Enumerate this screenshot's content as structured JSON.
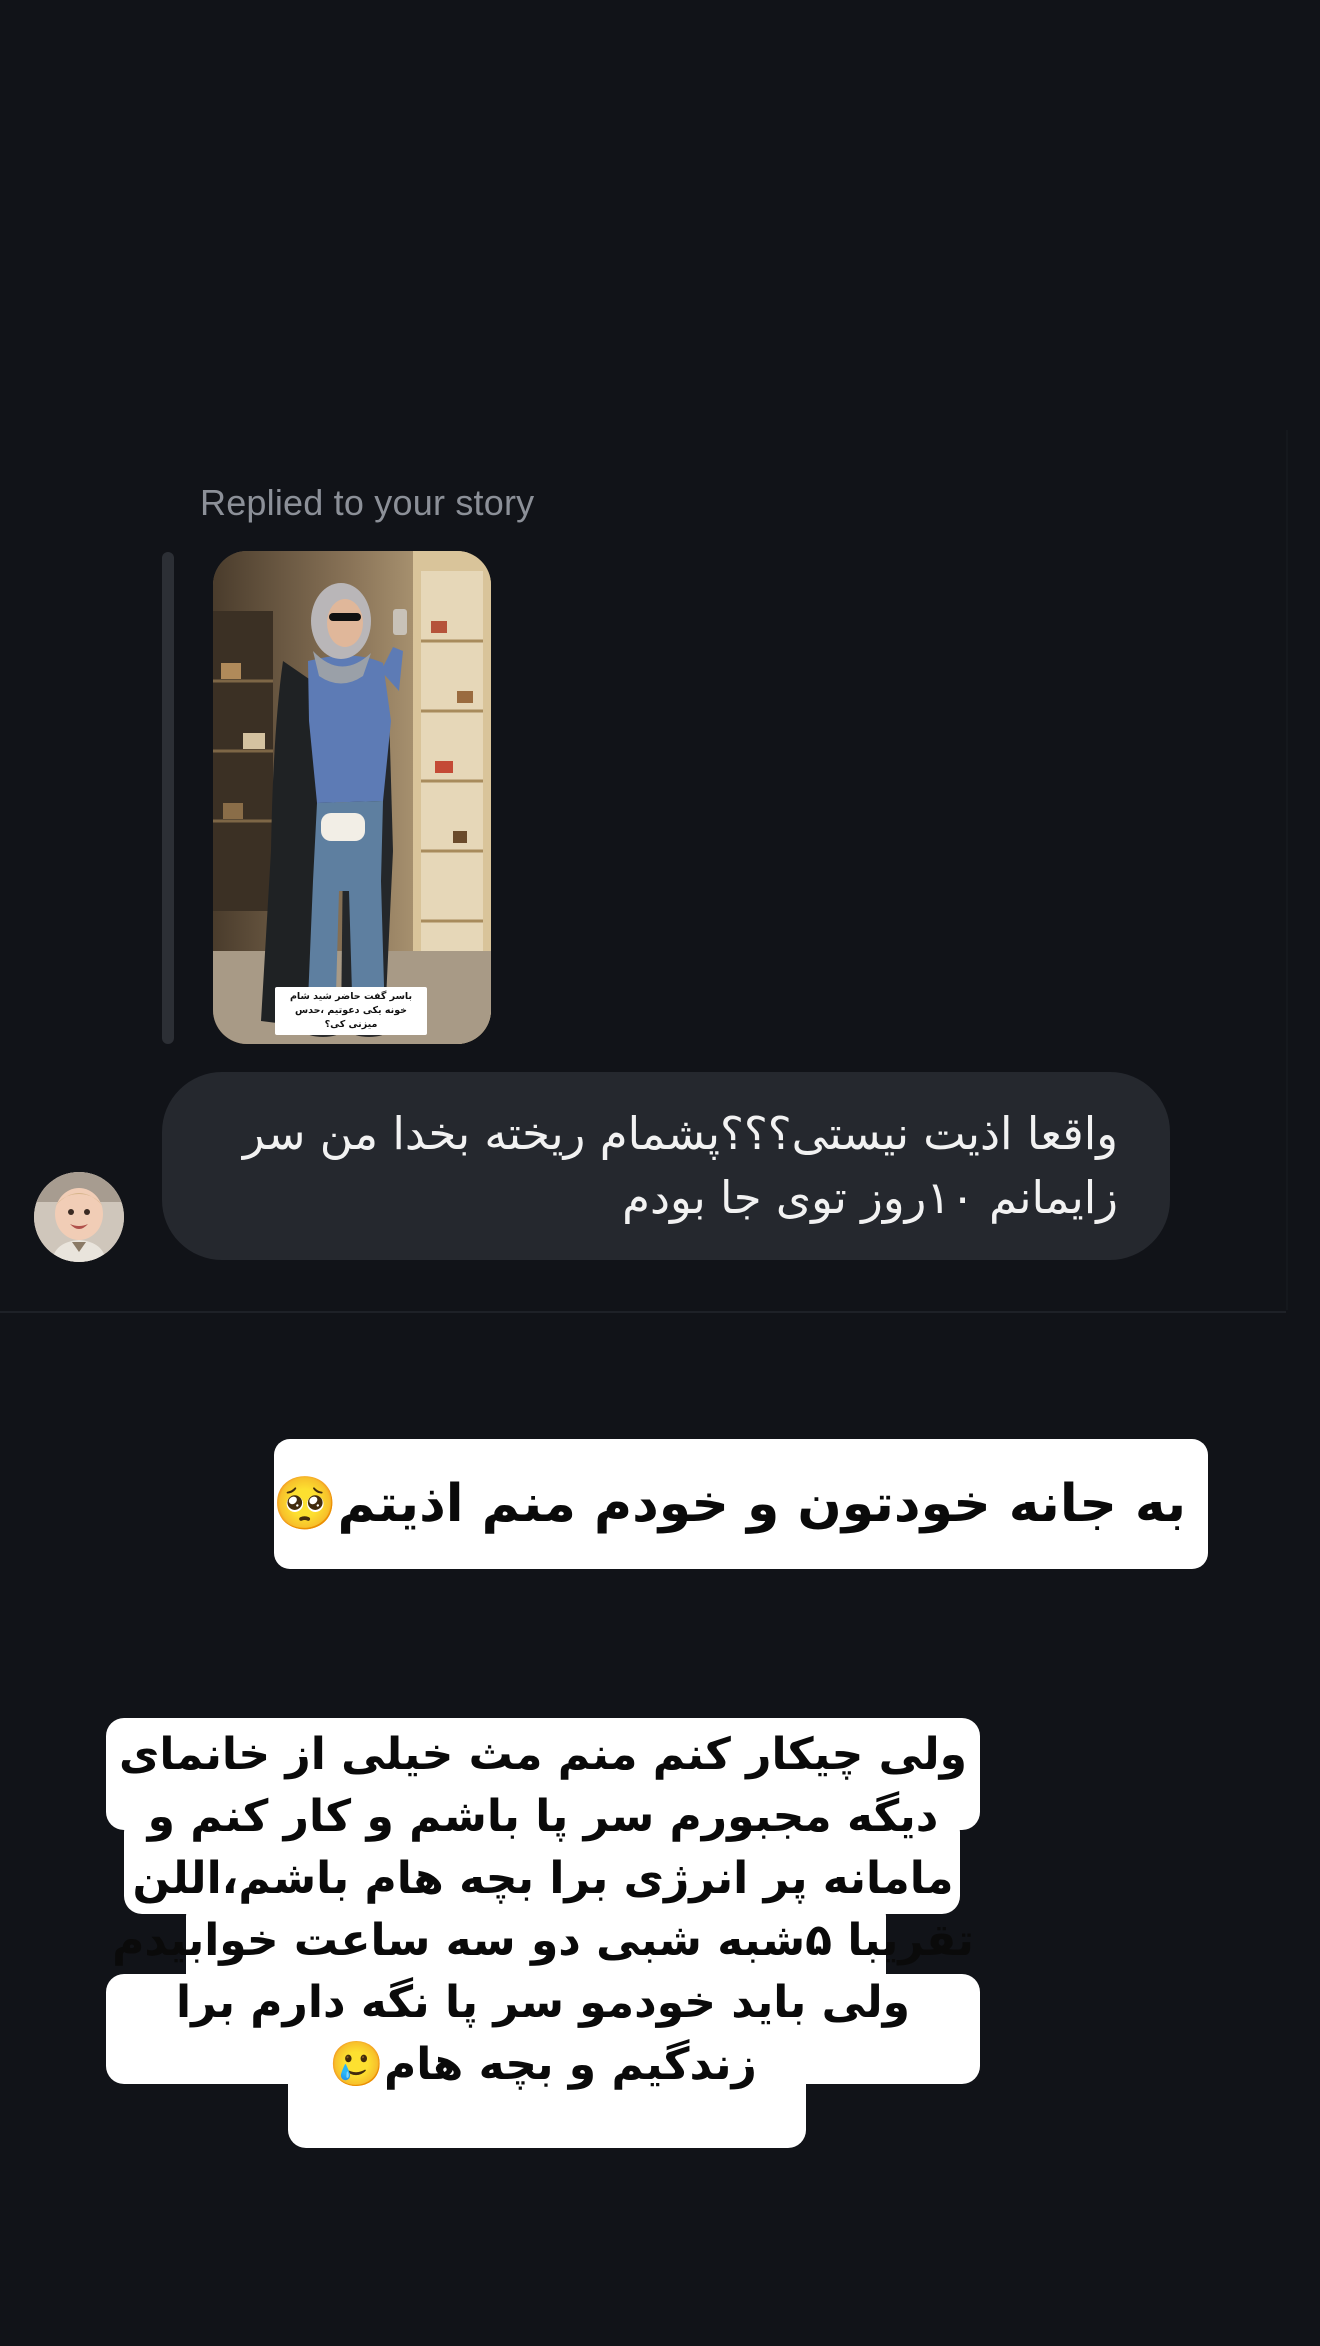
{
  "thread": {
    "replied_label": "Replied to your story",
    "story_caption": "باسر گفت حاضر شید شام خونه یکی دعوتیم ،حدس میزنی کی؟",
    "received_message": "واقعا اذیت نیستی؟؟؟پشمام ریخته بخدا من سر زایمانم ۱۰روز توی جا بودم"
  },
  "stickers": {
    "first": "به جانه خودتون و خودم منم اذیتم🥺",
    "second": "ولی چیکار کنم منم مث خیلی از خانمای دیگه مجبورم سر پا باشم و کار کنم و مامانه پر انرژی برا بچه هام باشم،اللن تقریبا ۵شبه شبی دو سه ساعت خوابیدم ولی باید خودمو سر پا نگه دارم برا زندگیم و بچه هام🥲"
  },
  "colors": {
    "background": "#111318",
    "bubble": "#25282e",
    "label": "#8c9098",
    "sticker": "#ffffff"
  },
  "icons": {
    "avatar": "baby-avatar"
  }
}
